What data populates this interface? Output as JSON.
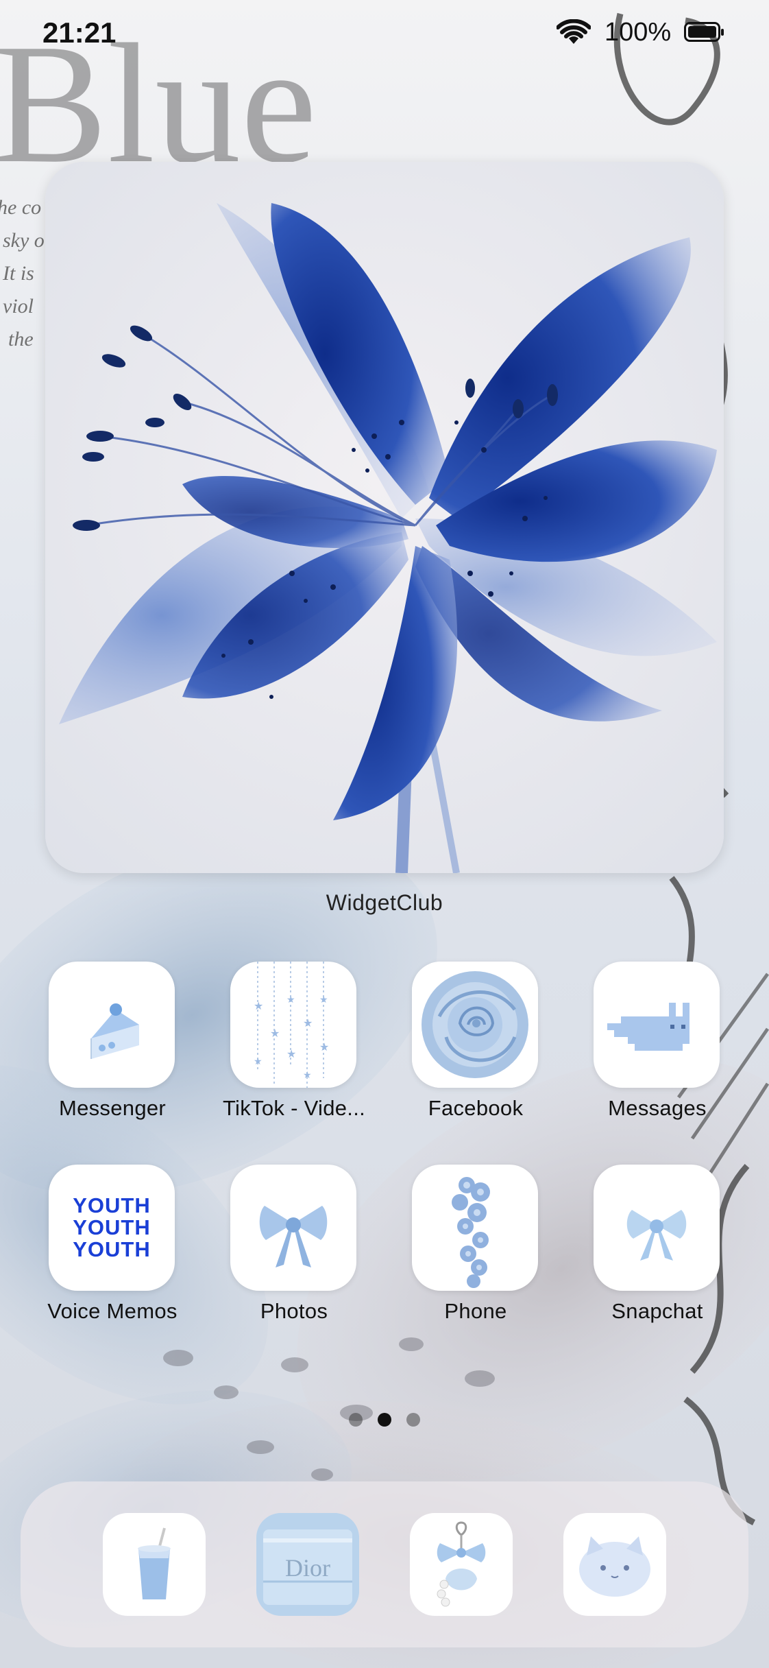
{
  "status_bar": {
    "time": "21:21",
    "battery_percent": "100%"
  },
  "wallpaper": {
    "word": "Blue",
    "text_lines": [
      "he co",
      "sky o",
      "It is",
      "viol",
      "the"
    ]
  },
  "widget": {
    "name": "WidgetClub"
  },
  "apps": [
    {
      "label": "Messenger",
      "icon": "cake-icon"
    },
    {
      "label": "TikTok - Vide...",
      "icon": "hanging-stars-icon"
    },
    {
      "label": "Facebook",
      "icon": "blue-rose-icon"
    },
    {
      "label": "Messages",
      "icon": "pixel-cat-icon"
    },
    {
      "label": "Voice Memos",
      "icon": "youth-text-icon",
      "icon_text": [
        "YOUTH",
        "YOUTH",
        "YOUTH"
      ]
    },
    {
      "label": "Photos",
      "icon": "bow-icon"
    },
    {
      "label": "Phone",
      "icon": "blue-flowers-icon"
    },
    {
      "label": "Snapchat",
      "icon": "bow-icon"
    }
  ],
  "page_dots": {
    "count": 3,
    "active_index": 1
  },
  "dock": [
    {
      "icon": "iced-drink-icon"
    },
    {
      "icon": "dior-bag-icon",
      "text": "Dior"
    },
    {
      "icon": "bow-shell-charm-icon"
    },
    {
      "icon": "plush-cat-icon"
    }
  ],
  "colors": {
    "accent_blue": "#1f3fa3",
    "youth_blue": "#1a3fd6",
    "light_blue": "#a9c6e8"
  }
}
